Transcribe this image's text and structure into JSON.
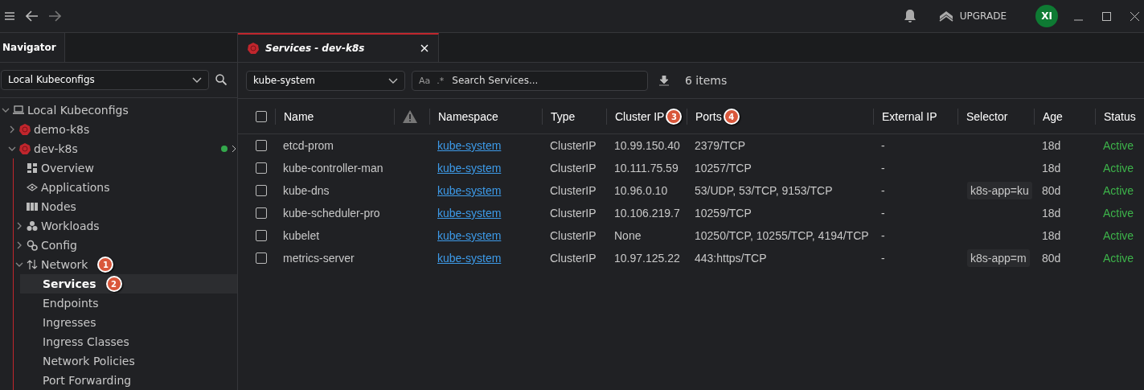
{
  "top_bar": {
    "upgrade_label": "UPGRADE",
    "avatar": "XI"
  },
  "navigator": {
    "tab": "Navigator",
    "source": "Local Kubeconfigs",
    "tree": [
      {
        "label": "Local Kubeconfigs",
        "kind": "laptop",
        "expanded": true,
        "selected": false,
        "children": [
          {
            "label": "demo-k8s",
            "kind": "cluster",
            "expanded": false,
            "selected": false
          },
          {
            "label": "dev-k8s",
            "kind": "cluster",
            "expanded": true,
            "selected": false,
            "connected": true,
            "children": [
              {
                "label": "Overview",
                "kind": "overview",
                "selected": false
              },
              {
                "label": "Applications",
                "kind": "applications",
                "selected": false
              },
              {
                "label": "Nodes",
                "kind": "nodes",
                "selected": false
              },
              {
                "label": "Workloads",
                "kind": "workloads",
                "expanded": false,
                "selected": false
              },
              {
                "label": "Config",
                "kind": "config",
                "expanded": false,
                "selected": false
              },
              {
                "label": "Network",
                "kind": "network",
                "expanded": true,
                "selected": false,
                "badge": "1",
                "children": [
                  {
                    "label": "Services",
                    "kind": "plain",
                    "selected": true,
                    "badge": "2"
                  },
                  {
                    "label": "Endpoints",
                    "kind": "plain",
                    "selected": false
                  },
                  {
                    "label": "Ingresses",
                    "kind": "plain",
                    "selected": false
                  },
                  {
                    "label": "Ingress Classes",
                    "kind": "plain",
                    "selected": false
                  },
                  {
                    "label": "Network Policies",
                    "kind": "plain",
                    "selected": false
                  },
                  {
                    "label": "Port Forwarding",
                    "kind": "plain",
                    "selected": false
                  }
                ]
              }
            ]
          }
        ]
      }
    ]
  },
  "tab": {
    "title": "Services - dev-k8s",
    "selected": true
  },
  "toolbar": {
    "namespace": "kube-system",
    "case_toggle": "Aa",
    "regex_toggle": ".*",
    "search_placeholder": "Search Services...",
    "count": "6 items"
  },
  "table": {
    "select_all": false,
    "columns": [
      {
        "kind": "check"
      },
      {
        "label": "Name",
        "kind": "text"
      },
      {
        "kind": "warning"
      },
      {
        "label": "Namespace",
        "kind": "text"
      },
      {
        "label": "Type",
        "kind": "text"
      },
      {
        "label": "Cluster IP",
        "kind": "text",
        "badge": "3"
      },
      {
        "label": "Ports",
        "kind": "text",
        "badge": "4"
      },
      {
        "label": "External IP",
        "kind": "text"
      },
      {
        "label": "Selector",
        "kind": "text"
      },
      {
        "label": "Age",
        "kind": "text"
      },
      {
        "label": "Status",
        "kind": "text"
      }
    ],
    "rows": [
      {
        "checked": false,
        "name": "etcd-prom",
        "namespace": "kube-system",
        "type": "ClusterIP",
        "cluster_ip": "10.99.150.40",
        "ports": "2379/TCP",
        "external_ip": "-",
        "age": "18d",
        "status": "Active"
      },
      {
        "checked": false,
        "name": "kube-controller-man",
        "namespace": "kube-system",
        "type": "ClusterIP",
        "cluster_ip": "10.111.75.59",
        "ports": "10257/TCP",
        "external_ip": "-",
        "age": "18d",
        "status": "Active"
      },
      {
        "checked": false,
        "name": "kube-dns",
        "namespace": "kube-system",
        "type": "ClusterIP",
        "cluster_ip": "10.96.0.10",
        "ports": "53/UDP, 53/TCP, 9153/TCP",
        "external_ip": "-",
        "selector": "k8s-app=ku",
        "age": "80d",
        "status": "Active"
      },
      {
        "checked": false,
        "name": "kube-scheduler-pro",
        "namespace": "kube-system",
        "type": "ClusterIP",
        "cluster_ip": "10.106.219.7",
        "ports": "10259/TCP",
        "external_ip": "-",
        "age": "18d",
        "status": "Active"
      },
      {
        "checked": false,
        "name": "kubelet",
        "namespace": "kube-system",
        "type": "ClusterIP",
        "cluster_ip": "None",
        "ports": "10250/TCP, 10255/TCP, 4194/TCP",
        "external_ip": "-",
        "age": "18d",
        "status": "Active"
      },
      {
        "checked": false,
        "name": "metrics-server",
        "namespace": "kube-system",
        "type": "ClusterIP",
        "cluster_ip": "10.97.125.22",
        "ports": "443:https/TCP",
        "external_ip": "-",
        "selector": "k8s-app=m",
        "age": "80d",
        "status": "Active"
      }
    ]
  }
}
